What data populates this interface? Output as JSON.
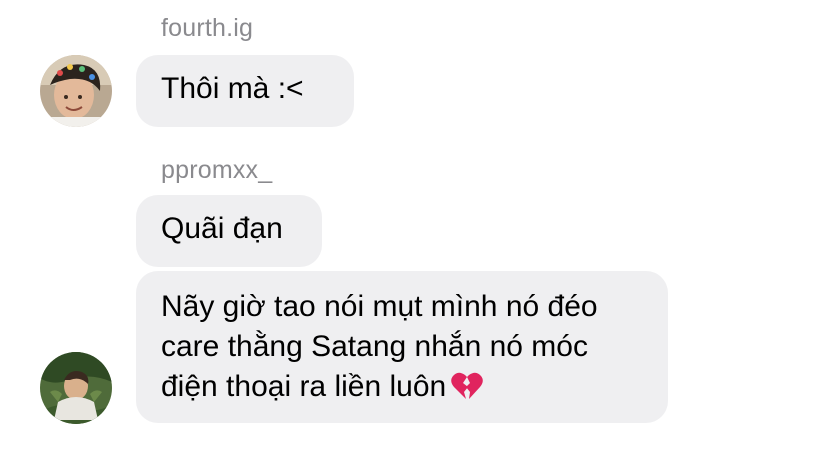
{
  "thread": [
    {
      "sender": "fourth.ig",
      "messages": [
        "Thôi mà :<"
      ]
    },
    {
      "sender": "ppromxx_",
      "messages": [
        "Quãi đạn",
        "Nãy giờ tao nói mụt mình nó đéo care thằng Satang nhắn nó móc điện thoại ra liền luôn"
      ],
      "emoji": "broken-heart-icon"
    }
  ],
  "colors": {
    "bubble_bg": "#efeff1",
    "sender_text": "#8a8a8e",
    "message_text": "#000000",
    "heart": "#e0245e"
  }
}
